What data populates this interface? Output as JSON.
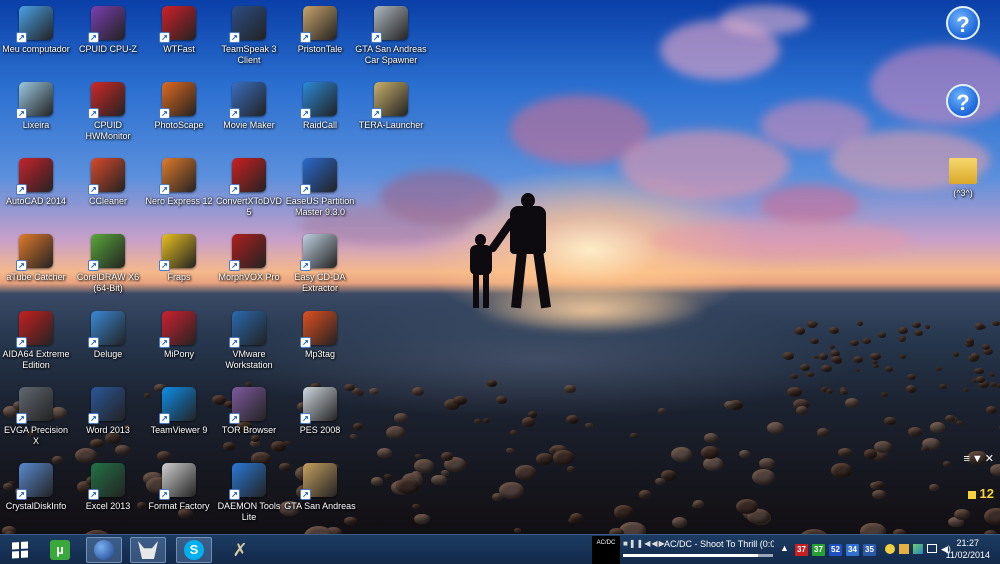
{
  "desktop_icons": [
    {
      "label": "Meu computador",
      "icon": "computer-icon",
      "color": "#4aa3e8"
    },
    {
      "label": "CPUID CPU-Z",
      "icon": "cpuz-icon",
      "color": "#7a3fb0"
    },
    {
      "label": "WTFast",
      "icon": "wtfast-icon",
      "color": "#d0202a"
    },
    {
      "label": "TeamSpeak 3 Client",
      "icon": "teamspeak-icon",
      "color": "#2d4e86"
    },
    {
      "label": "PristonTale",
      "icon": "pristontale-icon",
      "color": "#c8a46a"
    },
    {
      "label": "GTA San Andreas Car Spawner",
      "icon": "gta-spawner-icon",
      "color": "#b0b8c0"
    },
    {
      "label": "Lixeira",
      "icon": "recycle-bin-icon",
      "color": "#9cc8e0"
    },
    {
      "label": "CPUID HWMonitor",
      "icon": "hwmonitor-icon",
      "color": "#d02828"
    },
    {
      "label": "PhotoScape",
      "icon": "photoscape-icon",
      "color": "#e06a1e"
    },
    {
      "label": "Movie Maker",
      "icon": "movie-maker-icon",
      "color": "#3a6ec0"
    },
    {
      "label": "RaidCall",
      "icon": "raidcall-icon",
      "color": "#2a8ad8"
    },
    {
      "label": "TERA-Launcher",
      "icon": "tera-launcher-icon",
      "color": "#c9b06a"
    },
    {
      "label": "AutoCAD 2014",
      "icon": "autocad-icon",
      "color": "#c8232c"
    },
    {
      "label": "CCleaner",
      "icon": "ccleaner-icon",
      "color": "#d84a2a"
    },
    {
      "label": "Nero Express 12",
      "icon": "nero-icon",
      "color": "#e07a2a"
    },
    {
      "label": "ConvertXToDVD 5",
      "icon": "convertx-icon",
      "color": "#cc2020"
    },
    {
      "label": "EaseUS Partition Master 9.3.0",
      "icon": "easeus-icon",
      "color": "#2a6ad0"
    },
    {
      "label": "aTube Catcher",
      "icon": "atube-icon",
      "color": "#e07a2a"
    },
    {
      "label": "CorelDRAW X6 (64-Bit)",
      "icon": "coreldraw-icon",
      "color": "#5aa83a"
    },
    {
      "label": "Fraps",
      "icon": "fraps-icon",
      "color": "#e8c020"
    },
    {
      "label": "MorphVOX Pro",
      "icon": "morphvox-icon",
      "color": "#b02020"
    },
    {
      "label": "Easy CD-DA Extractor",
      "icon": "easy-cdda-icon",
      "color": "#c0d0e0"
    },
    {
      "label": "AIDA64 Extreme Edition",
      "icon": "aida64-icon",
      "color": "#c82020"
    },
    {
      "label": "Deluge",
      "icon": "deluge-icon",
      "color": "#3a8ad8"
    },
    {
      "label": "MiPony",
      "icon": "mipony-icon",
      "color": "#d02030"
    },
    {
      "label": "VMware Workstation",
      "icon": "vmware-icon",
      "color": "#2a6ab0"
    },
    {
      "label": "Mp3tag",
      "icon": "mp3tag-icon",
      "color": "#e05020"
    },
    {
      "label": "EVGA Precision X",
      "icon": "evga-icon",
      "color": "#606870"
    },
    {
      "label": "Word 2013",
      "icon": "word-icon",
      "color": "#2b579a"
    },
    {
      "label": "TeamViewer 9",
      "icon": "teamviewer-icon",
      "color": "#0e8ee9"
    },
    {
      "label": "TOR Browser",
      "icon": "tor-icon",
      "color": "#7e5aa0"
    },
    {
      "label": "PES 2008",
      "icon": "pes-icon",
      "color": "#d0d8e0"
    },
    {
      "label": "CrystalDiskInfo",
      "icon": "crystaldiskinfo-icon",
      "color": "#5a8ad0"
    },
    {
      "label": "Excel 2013",
      "icon": "excel-icon",
      "color": "#217346"
    },
    {
      "label": "Format Factory",
      "icon": "format-factory-icon",
      "color": "#d0d0d0"
    },
    {
      "label": "DAEMON Tools Lite",
      "icon": "daemon-tools-icon",
      "color": "#2a7ad8"
    },
    {
      "label": "GTA San Andreas",
      "icon": "gta-sa-icon",
      "color": "#c8a060"
    }
  ],
  "right_icons": {
    "help1": "?",
    "help2": "?",
    "folder_label": "(^3^)"
  },
  "gadget": {
    "controls": "≡▼✕",
    "value": "12"
  },
  "taskbar": {
    "media_title": "AC/DC - Shoot To Thrill (0:0",
    "media_thumb_text": "AC/DC",
    "media_progress": 0.9,
    "tray_badges": [
      {
        "text": "37",
        "color": "#c82020"
      },
      {
        "text": "37",
        "color": "#28a030"
      },
      {
        "text": "52",
        "color": "#2050c0"
      },
      {
        "text": "34",
        "color": "#3070d0"
      },
      {
        "text": "35",
        "color": "#2a5aa8"
      }
    ],
    "time": "21:27",
    "date": "11/02/2014"
  }
}
